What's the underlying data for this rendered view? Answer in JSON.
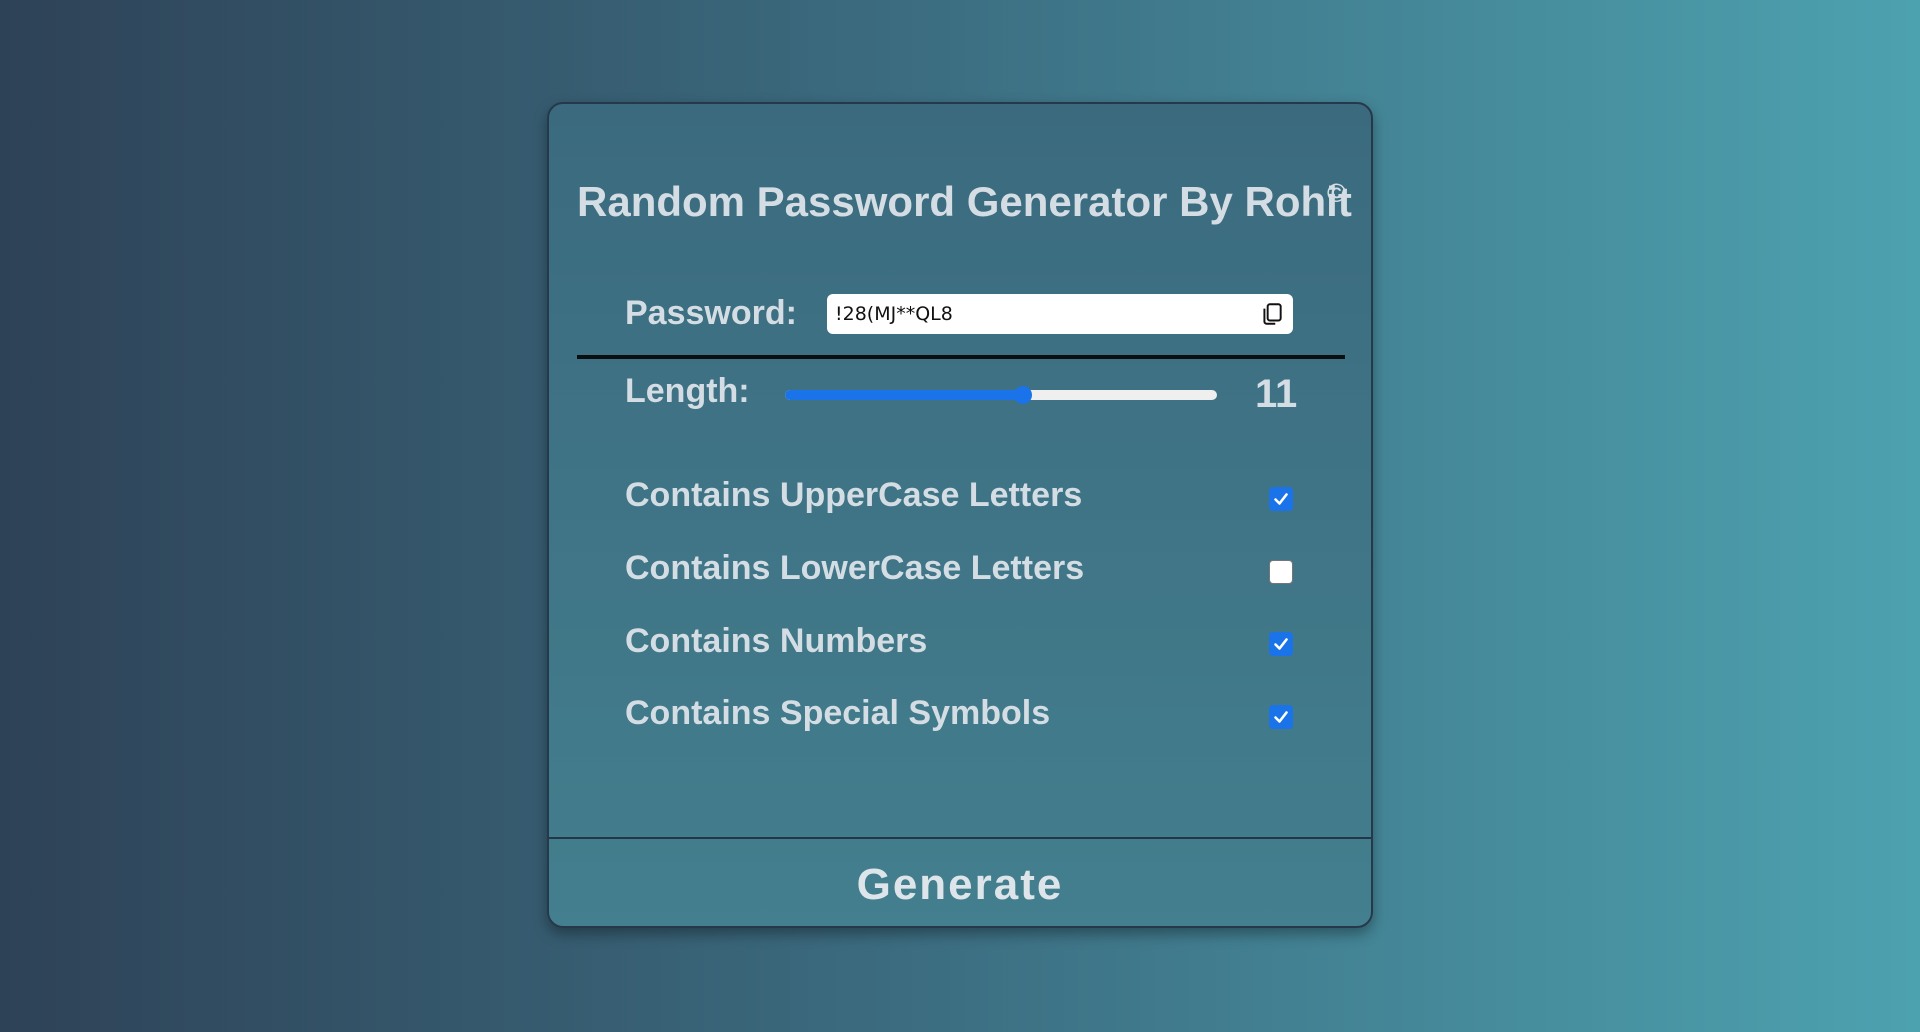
{
  "app": {
    "title": "Random Password Generator By Rohit",
    "copyright_symbol": "©"
  },
  "password": {
    "label": "Password:",
    "value": "!28(MJ**QL8",
    "copy_icon": "copy-icon"
  },
  "length": {
    "label": "Length:",
    "value": "11",
    "slider_fraction": 0.55
  },
  "options": [
    {
      "label": "Contains UpperCase Letters",
      "checked": true
    },
    {
      "label": "Contains LowerCase Letters",
      "checked": false
    },
    {
      "label": "Contains Numbers",
      "checked": true
    },
    {
      "label": "Contains Special Symbols",
      "checked": true
    }
  ],
  "actions": {
    "generate_label": "Generate"
  },
  "colors": {
    "accent": "#1a73e8",
    "text": "#d3dde3",
    "background_start": "#2e4257",
    "background_end": "#4da2b0"
  }
}
